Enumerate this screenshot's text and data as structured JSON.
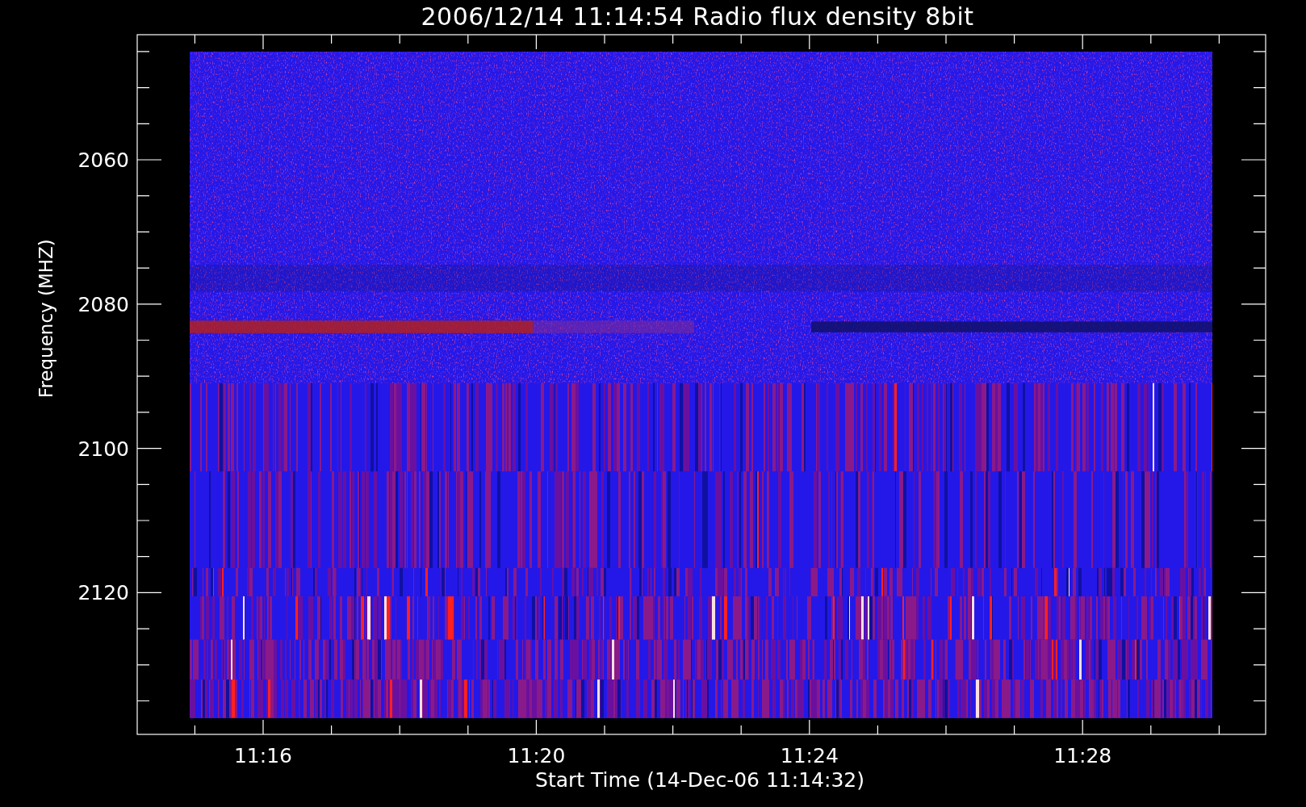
{
  "title": "2006/12/14 11:14:54 Radio flux density 8bit",
  "plot": {
    "ylabel": "Frequency (MHZ)",
    "xlabel": "Start Time (14-Dec-06 11:14:32)",
    "yticks": [
      "2060",
      "2080",
      "2100",
      "2120"
    ],
    "xticks": [
      "11:16",
      "11:20",
      "11:24",
      "11:28"
    ]
  }
}
